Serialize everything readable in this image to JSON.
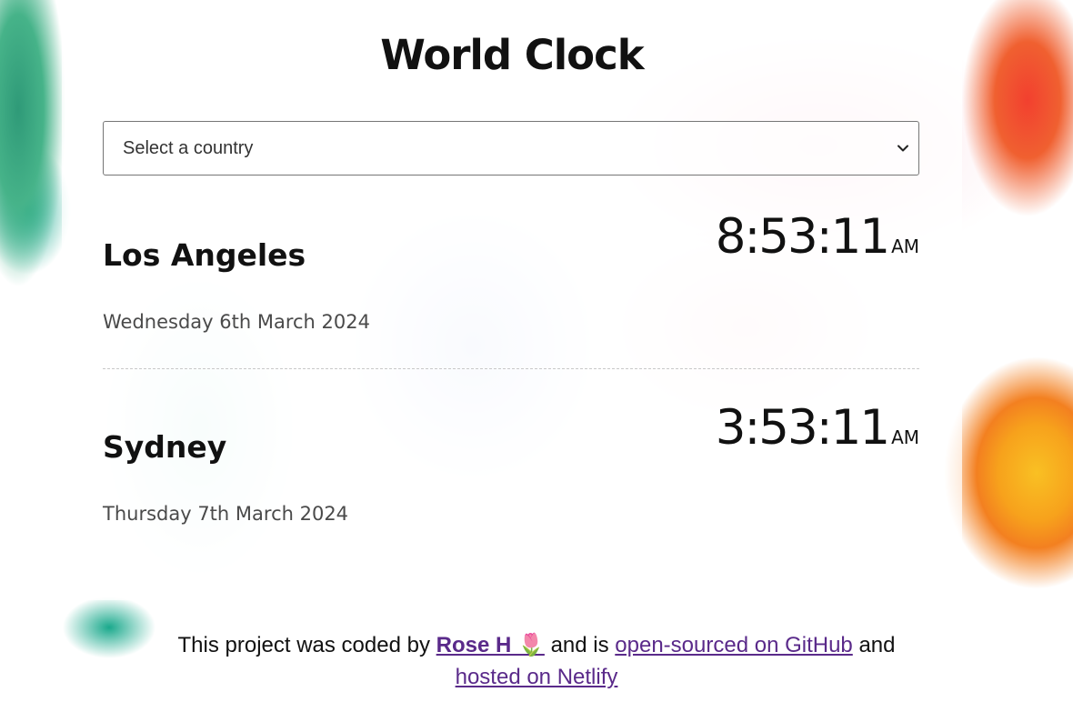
{
  "app": {
    "title": "World Clock"
  },
  "country_select": {
    "selected": "Select a country",
    "icon": "chevron-down-icon"
  },
  "cities": [
    {
      "name": "Los Angeles",
      "date": "Wednesday 6th March 2024",
      "time": "8:53:11",
      "ampm": "AM"
    },
    {
      "name": "Sydney",
      "date": "Thursday 7th March 2024",
      "time": "3:53:11",
      "ampm": "AM"
    }
  ],
  "footer": {
    "text_1": "This project was coded by",
    "author_link": "Rose H 🌷",
    "text_2": "and is",
    "github_link": "open-sourced on GitHub",
    "text_3": "and",
    "netlify_link": "hosted on Netlify"
  },
  "colors": {
    "link": "#5a2a8a",
    "text": "#111111",
    "muted_text": "#4a4a4a"
  }
}
